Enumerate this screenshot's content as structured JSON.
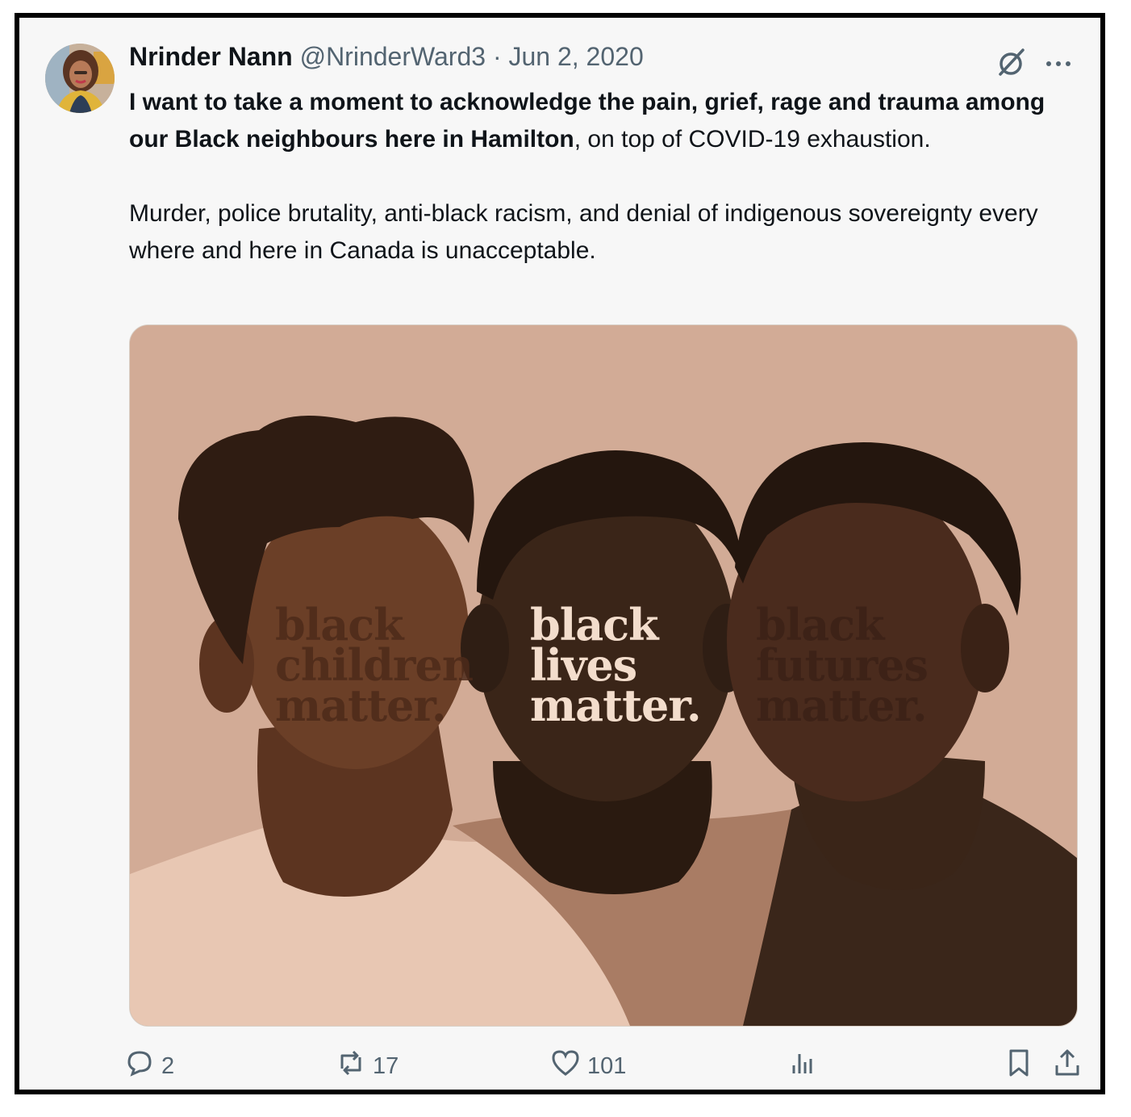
{
  "author": {
    "name": "Nrinder Nann",
    "handle": "@NrinderWard3",
    "date": "Jun 2, 2020",
    "separator": "·"
  },
  "tweet": {
    "bold_text": "I want to take a moment to acknowledge the pain, grief, rage and trauma among our Black neighbours here in Hamilton",
    "regular_text": ", on top of COVID-19 exhaustion.",
    "paragraph2": "Murder, police brutality, anti-black racism, and denial of indigenous sovereignty every where and here in Canada is unacceptable."
  },
  "image": {
    "left_face": [
      "black",
      "children",
      "matter."
    ],
    "center_face": [
      "black",
      "lives",
      "matter."
    ],
    "right_face": [
      "black",
      "futures",
      "matter."
    ],
    "colors": {
      "background": "#d2ab96",
      "left_skin": "#6b3f27",
      "center_skin": "#3a2518",
      "right_skin": "#4a2b1d",
      "hair": "#2b1a12"
    }
  },
  "actions": {
    "replies": "2",
    "reposts": "17",
    "likes": "101"
  },
  "icons": [
    "grok-icon",
    "more-icon",
    "reply-icon",
    "repost-icon",
    "like-icon",
    "views-icon",
    "bookmark-icon",
    "share-icon"
  ]
}
